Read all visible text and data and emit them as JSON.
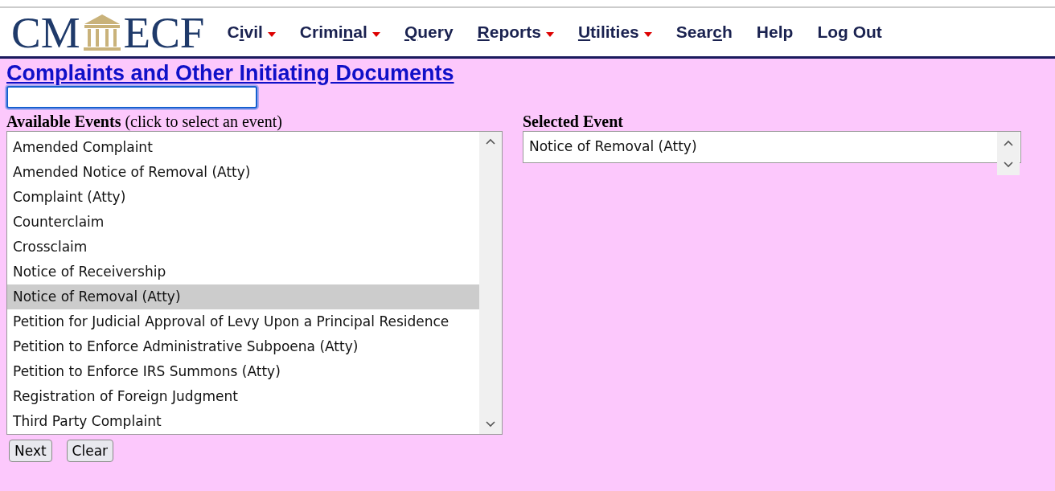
{
  "logo": {
    "left": "CM",
    "right": "ECF"
  },
  "menu": [
    {
      "before": "C",
      "key": "i",
      "after": "vil",
      "dropdown": true
    },
    {
      "before": "Crimi",
      "key": "n",
      "after": "al",
      "dropdown": true
    },
    {
      "key": "Q",
      "after": "uery",
      "dropdown": false
    },
    {
      "key": "R",
      "after": "eports",
      "dropdown": true
    },
    {
      "key": "U",
      "after": "tilities",
      "dropdown": true
    },
    {
      "before": "Sear",
      "key": "c",
      "after": "h",
      "dropdown": false
    },
    {
      "before": "Help",
      "dropdown": false
    },
    {
      "before": "Log Out",
      "dropdown": false
    }
  ],
  "heading": "Complaints and Other Initiating Documents",
  "available": {
    "label": "Available Events",
    "hint": "(click to select an event)",
    "items": [
      {
        "label": "Amended Complaint",
        "selected": false
      },
      {
        "label": "Amended Notice of Removal (Atty)",
        "selected": false
      },
      {
        "label": "Complaint (Atty)",
        "selected": false
      },
      {
        "label": "Counterclaim",
        "selected": false
      },
      {
        "label": "Crossclaim",
        "selected": false
      },
      {
        "label": "Notice of Receivership",
        "selected": false
      },
      {
        "label": "Notice of Removal (Atty)",
        "selected": true
      },
      {
        "label": "Petition for Judicial Approval of Levy Upon a Principal Residence",
        "selected": false
      },
      {
        "label": "Petition to Enforce Administrative Subpoena (Atty)",
        "selected": false
      },
      {
        "label": "Petition to Enforce IRS Summons (Atty)",
        "selected": false
      },
      {
        "label": "Registration of Foreign Judgment",
        "selected": false
      },
      {
        "label": "Third Party Complaint",
        "selected": false
      }
    ]
  },
  "selected_event": {
    "label": "Selected Event",
    "items": [
      "Notice of Removal (Atty)"
    ]
  },
  "buttons": [
    "Next",
    "Clear"
  ]
}
